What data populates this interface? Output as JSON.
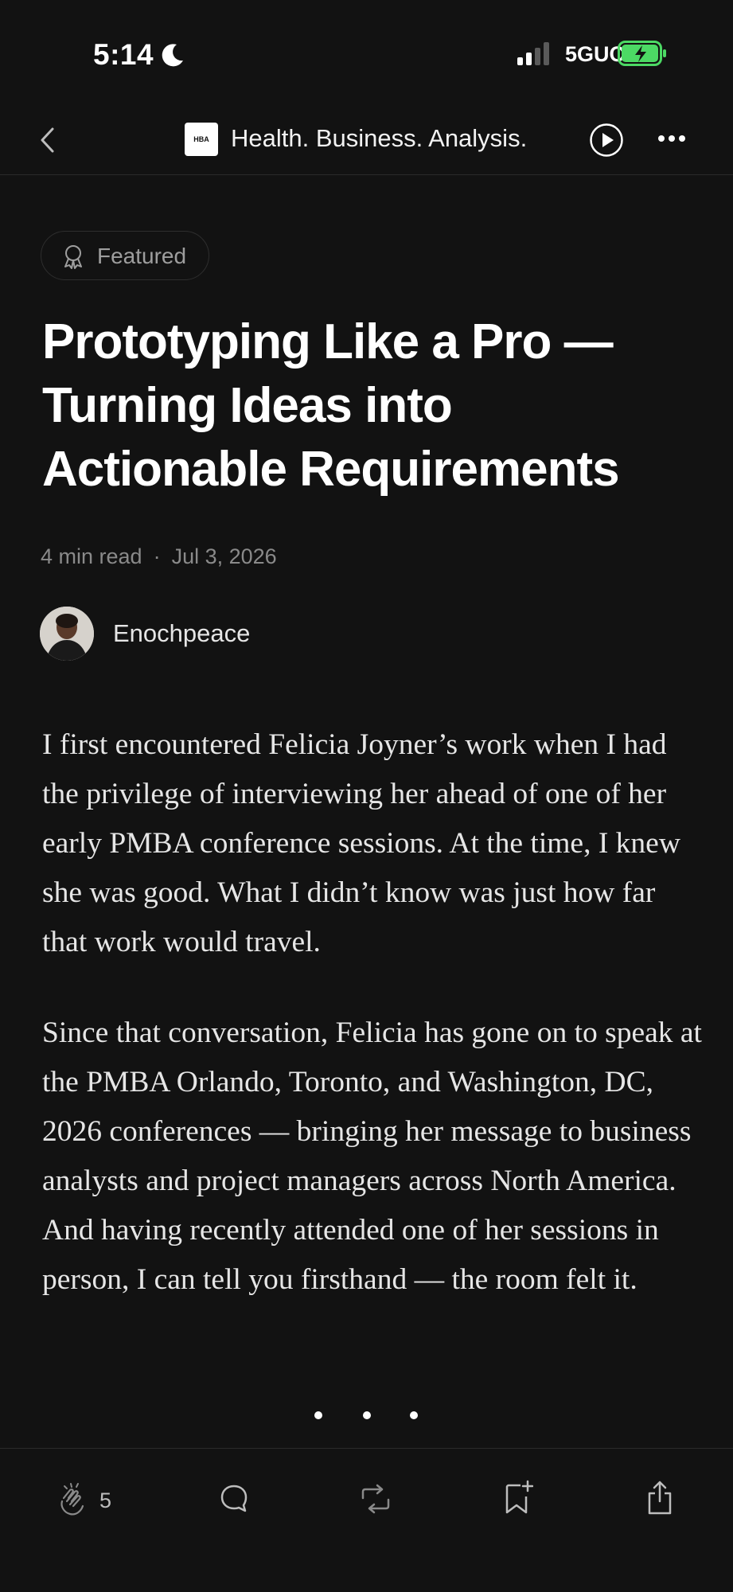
{
  "status_bar": {
    "time": "5:14",
    "network": "5GUC"
  },
  "nav": {
    "publication_logo_text": "HBA",
    "publication_name": "Health. Business. Analysis."
  },
  "badge": {
    "label": "Featured",
    "icon": "award-ribbon-icon"
  },
  "article": {
    "title": "Prototyping Like a Pro — Turning Ideas into Actionable Requirements",
    "read_time": "4 min read",
    "separator": "·",
    "date": "Jul 3, 2026",
    "author": "Enochpeace",
    "paragraphs": [
      "I first encountered Felicia Joyner’s work when I had the privilege of interviewing her ahead of one of her early PMBA conference sessions. At the time, I knew she was good. What I didn’t know was just how far that work would travel.",
      "Since that conversation, Felicia has gone on to speak at the PMBA Orlando, Toronto, and Washington, DC, 2026 conferences — bringing her message to business analysts and project managers across North America. And having recently attended one of her sessions in person, I can tell you firsthand — the room felt it."
    ]
  },
  "bottom_bar": {
    "clap_count": "5",
    "icons": [
      "clap-icon",
      "comment-icon",
      "repost-icon",
      "bookmark-add-icon",
      "share-icon"
    ]
  },
  "colors": {
    "background": "#121212",
    "text": "#ffffff",
    "muted": "#8a8a8a",
    "battery_green": "#4cd964"
  }
}
